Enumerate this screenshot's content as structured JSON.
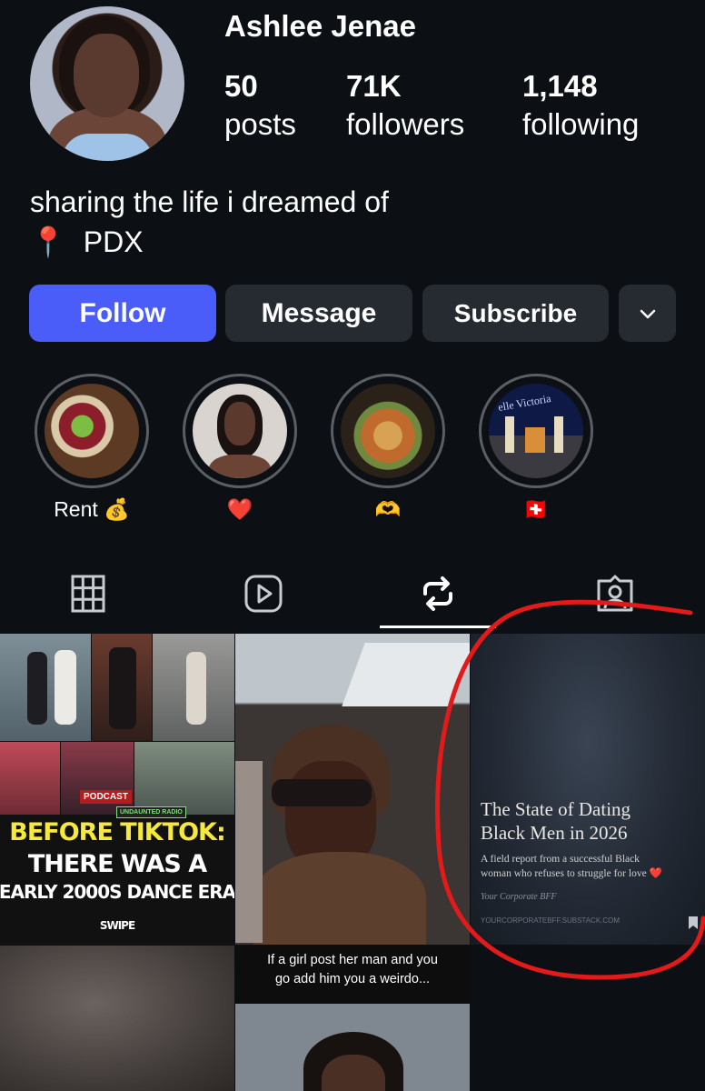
{
  "profile": {
    "name": "Ashlee Jenae",
    "stats": [
      {
        "value": "50",
        "label": "posts"
      },
      {
        "value": "71K",
        "label": "followers"
      },
      {
        "value": "1,148",
        "label": "following"
      }
    ],
    "bio_line1": "sharing the life i dreamed of",
    "bio_line2_icon": "📍",
    "bio_line2": "PDX"
  },
  "buttons": {
    "follow": "Follow",
    "message": "Message",
    "subscribe": "Subscribe"
  },
  "highlights": [
    {
      "label": "Rent 💰"
    },
    {
      "label": "❤️"
    },
    {
      "label": "🫶"
    },
    {
      "label": "🇨🇭"
    }
  ],
  "highlight_sign": "elle Victoria",
  "tabs": [
    "grid-icon",
    "reels-icon",
    "reposts-icon",
    "tagged-icon"
  ],
  "posts": {
    "post1": {
      "badge1": "PODCAST",
      "badge2": "UNDAUNTED RADIO",
      "line1": "BEFORE TIKTOK:",
      "line2": "THERE WAS A",
      "line3": "EARLY 2000S DANCE ERA",
      "logo": "SWIPE"
    },
    "post3": {
      "title_line1": "The State of Dating",
      "title_line2": "Black Men in 2026",
      "subtitle_line1": "A field report from a successful Black",
      "subtitle_line2": "woman who refuses to struggle for love ❤️",
      "author": "Your Corporate BFF",
      "url": "YOURCORPORATEBFF.SUBSTACK.COM"
    },
    "post5": {
      "caption_line1": "If a girl post her man and you",
      "caption_line2": "go add him you a weirdo..."
    }
  },
  "colors": {
    "background": "#0c1014",
    "follow_button": "#4a5df9",
    "secondary_button": "#262a31",
    "annotation": "#e21a1a"
  }
}
